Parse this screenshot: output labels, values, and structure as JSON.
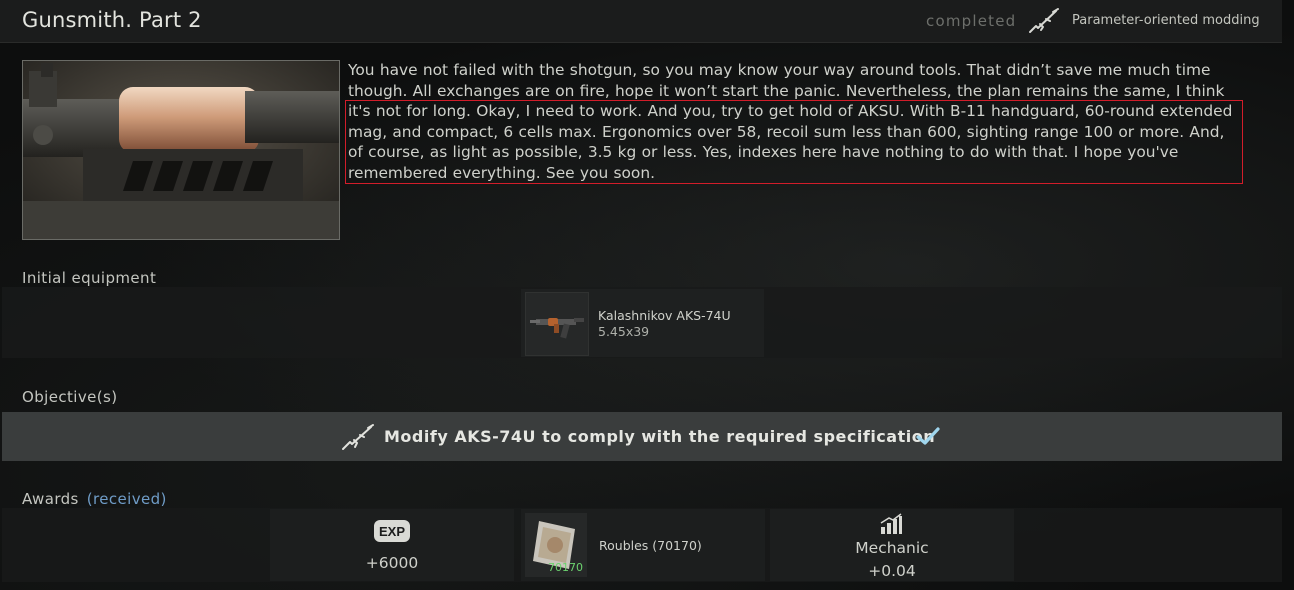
{
  "header": {
    "title": "Gunsmith. Part 2",
    "status": "completed",
    "type_icon": "rifle-icon",
    "type_label": "Parameter-oriented modding"
  },
  "description": {
    "text": "You have not failed with the shotgun, so you may know your way around tools. That didn’t save me much time though. All exchanges are on fire, hope it won’t start the panic. Nevertheless, the plan remains the same, I think it's not for long. Okay, I need to work. And you, try to get hold of AKSU. With B-11 handguard, 60-round extended mag, and compact, 6 cells max. Ergonomics over 58, recoil sum less than 600, sighting range 100 or more. And, of course, as light as possible, 3.5 kg or less. Yes, indexes here have nothing to do with that. I hope you've remembered everything. See you soon.",
    "highlight_color": "#d21d2a"
  },
  "initial_equipment": {
    "label": "Initial equipment",
    "items": [
      {
        "name": "Kalashnikov AKS-74U",
        "subtitle": "5.45x39",
        "icon": "aks74u-rifle-icon"
      }
    ]
  },
  "objectives": {
    "label": "Objective(s)",
    "items": [
      {
        "icon": "rifle-icon",
        "text": "Modify AKS-74U to comply with the required specification",
        "status_icon": "check-icon",
        "completed": true
      }
    ]
  },
  "awards": {
    "label": "Awards",
    "status": "(received)",
    "items": [
      {
        "kind": "experience",
        "icon": "exp-icon",
        "icon_text": "EXP",
        "value": "+6000"
      },
      {
        "kind": "money",
        "icon": "roubles-icon",
        "name": "Roubles (70170)",
        "amount": "70170"
      },
      {
        "kind": "skill",
        "icon": "skill-chart-icon",
        "name": "Mechanic",
        "value": "+0.04"
      }
    ]
  },
  "colors": {
    "accent_link": "#6f9cc7",
    "check": "#9fd6ee",
    "money_amount": "#6cd36f"
  }
}
